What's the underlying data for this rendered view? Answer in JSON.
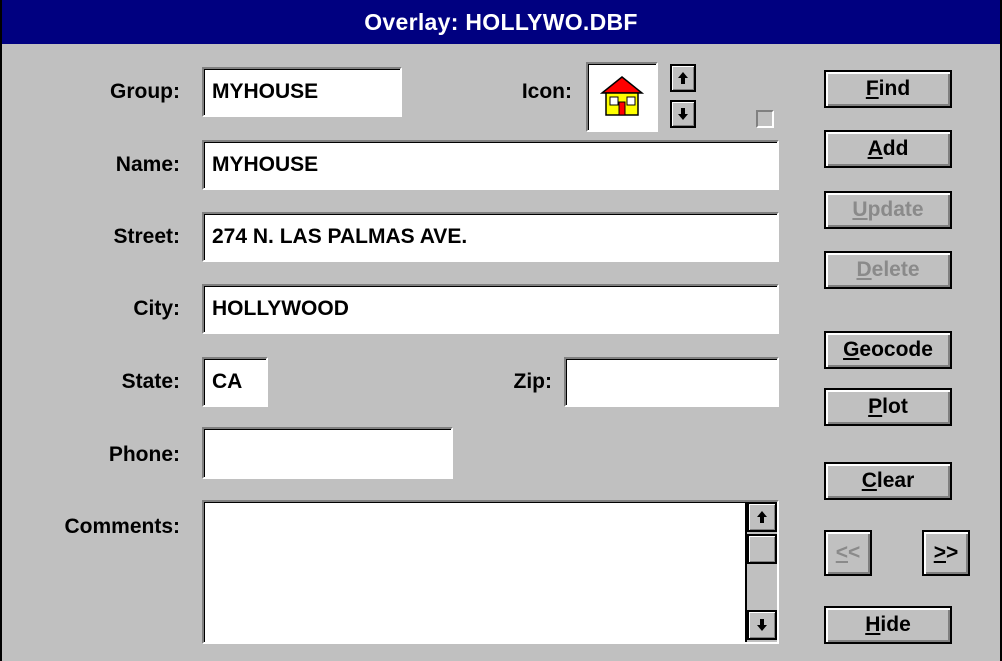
{
  "window": {
    "title": "Overlay: HOLLYWO.DBF"
  },
  "form": {
    "group_label": "Group:",
    "group_value": "MYHOUSE",
    "icon_label": "Icon:",
    "name_label": "Name:",
    "name_value": "MYHOUSE",
    "street_label": "Street:",
    "street_value": "274 N. LAS PALMAS AVE.",
    "city_label": "City:",
    "city_value": "HOLLYWOOD",
    "state_label": "State:",
    "state_value": "CA",
    "zip_label": "Zip:",
    "zip_value": "",
    "phone_label": "Phone:",
    "phone_value": "",
    "comments_label": "Comments:",
    "comments_value": ""
  },
  "buttons": {
    "find": {
      "first": "F",
      "rest": "ind"
    },
    "add": {
      "first": "A",
      "rest": "dd"
    },
    "update": {
      "first": "U",
      "rest": "pdate"
    },
    "delete": {
      "first": "D",
      "rest": "elete"
    },
    "geocode": {
      "first": "G",
      "rest": "eocode"
    },
    "plot": {
      "first": "P",
      "rest": "lot"
    },
    "clear": {
      "first": "C",
      "rest": "lear"
    },
    "prev": {
      "first": "<",
      "rest": "<"
    },
    "next": {
      "first": ">",
      "rest": ">"
    },
    "hide": {
      "first": "H",
      "rest": "ide"
    }
  },
  "icons": {
    "house": "house-icon",
    "up": "arrow-up-icon",
    "down": "arrow-down-icon"
  },
  "colors": {
    "titlebar": "#000080",
    "face": "#c0c0c0",
    "house_yellow": "#ffff00",
    "house_roof": "#ff0000"
  }
}
